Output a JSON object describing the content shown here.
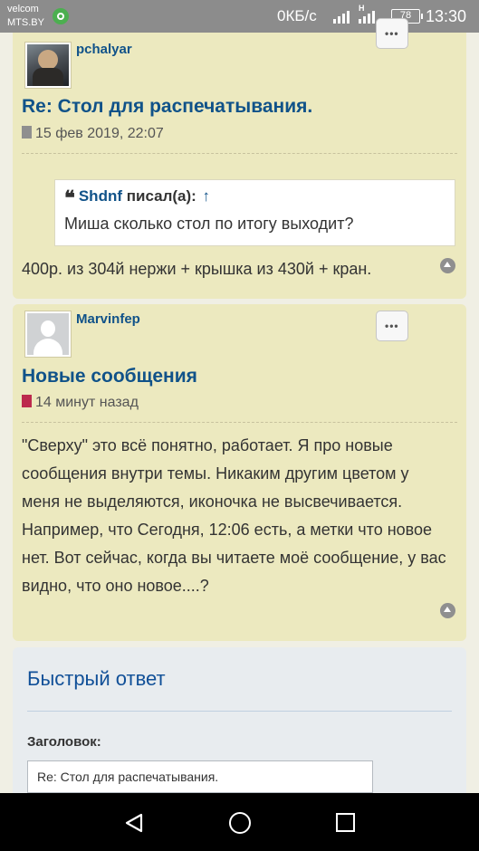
{
  "status_bar": {
    "carrier_line1": "velcom",
    "carrier_line2": "MTS.BY",
    "net_speed": "0КБ/с",
    "network_type": "H",
    "battery": "78",
    "time": "13:30"
  },
  "posts": [
    {
      "author": "pchalyar",
      "title": "Re: Стол для распечатывания.",
      "date": "15 фев 2019, 22:07",
      "quote": {
        "author": "Shdnf",
        "wrote": "писал(а):",
        "up_arrow": "↑",
        "text": "Миша сколько стол по итогу выходит?"
      },
      "text": "400р. из 304й нержи + крышка из 430й + кран.",
      "menu_label": "•••",
      "icons": {
        "avatar": "user-photo",
        "date": "file-icon",
        "quote": "quote-icon",
        "up": "arrow-up-icon",
        "menu": "more-icon"
      }
    },
    {
      "author": "Marvinfep",
      "title": "Новые сообщения",
      "date": "14 минут назад",
      "text": "\"Сверху\" это всё понятно, работает. Я про новые сообщения внутри темы. Никаким другим цветом у меня не выделяются, иконочка не высвечивается. Например, что Сегодня, 12:06 есть, а метки что новое нет. Вот сейчас, когда вы читаете моё сообщение, у вас видно, что оно новое....?",
      "menu_label": "•••",
      "icons": {
        "avatar": "default-avatar",
        "date": "unread-file-icon",
        "up": "arrow-up-icon",
        "menu": "more-icon"
      }
    }
  ],
  "quick_reply": {
    "title": "Быстрый ответ",
    "subject_label": "Заголовок:",
    "subject_value": "Re: Стол для распечатывания."
  },
  "nav_bar": {
    "icons": [
      "back-icon",
      "home-icon",
      "recent-apps-icon"
    ]
  },
  "colors": {
    "post_bg": "#ece9bf",
    "link": "#105289",
    "reply_panel_bg": "#e8ecef",
    "status_bar_bg": "#8c8c8c"
  }
}
